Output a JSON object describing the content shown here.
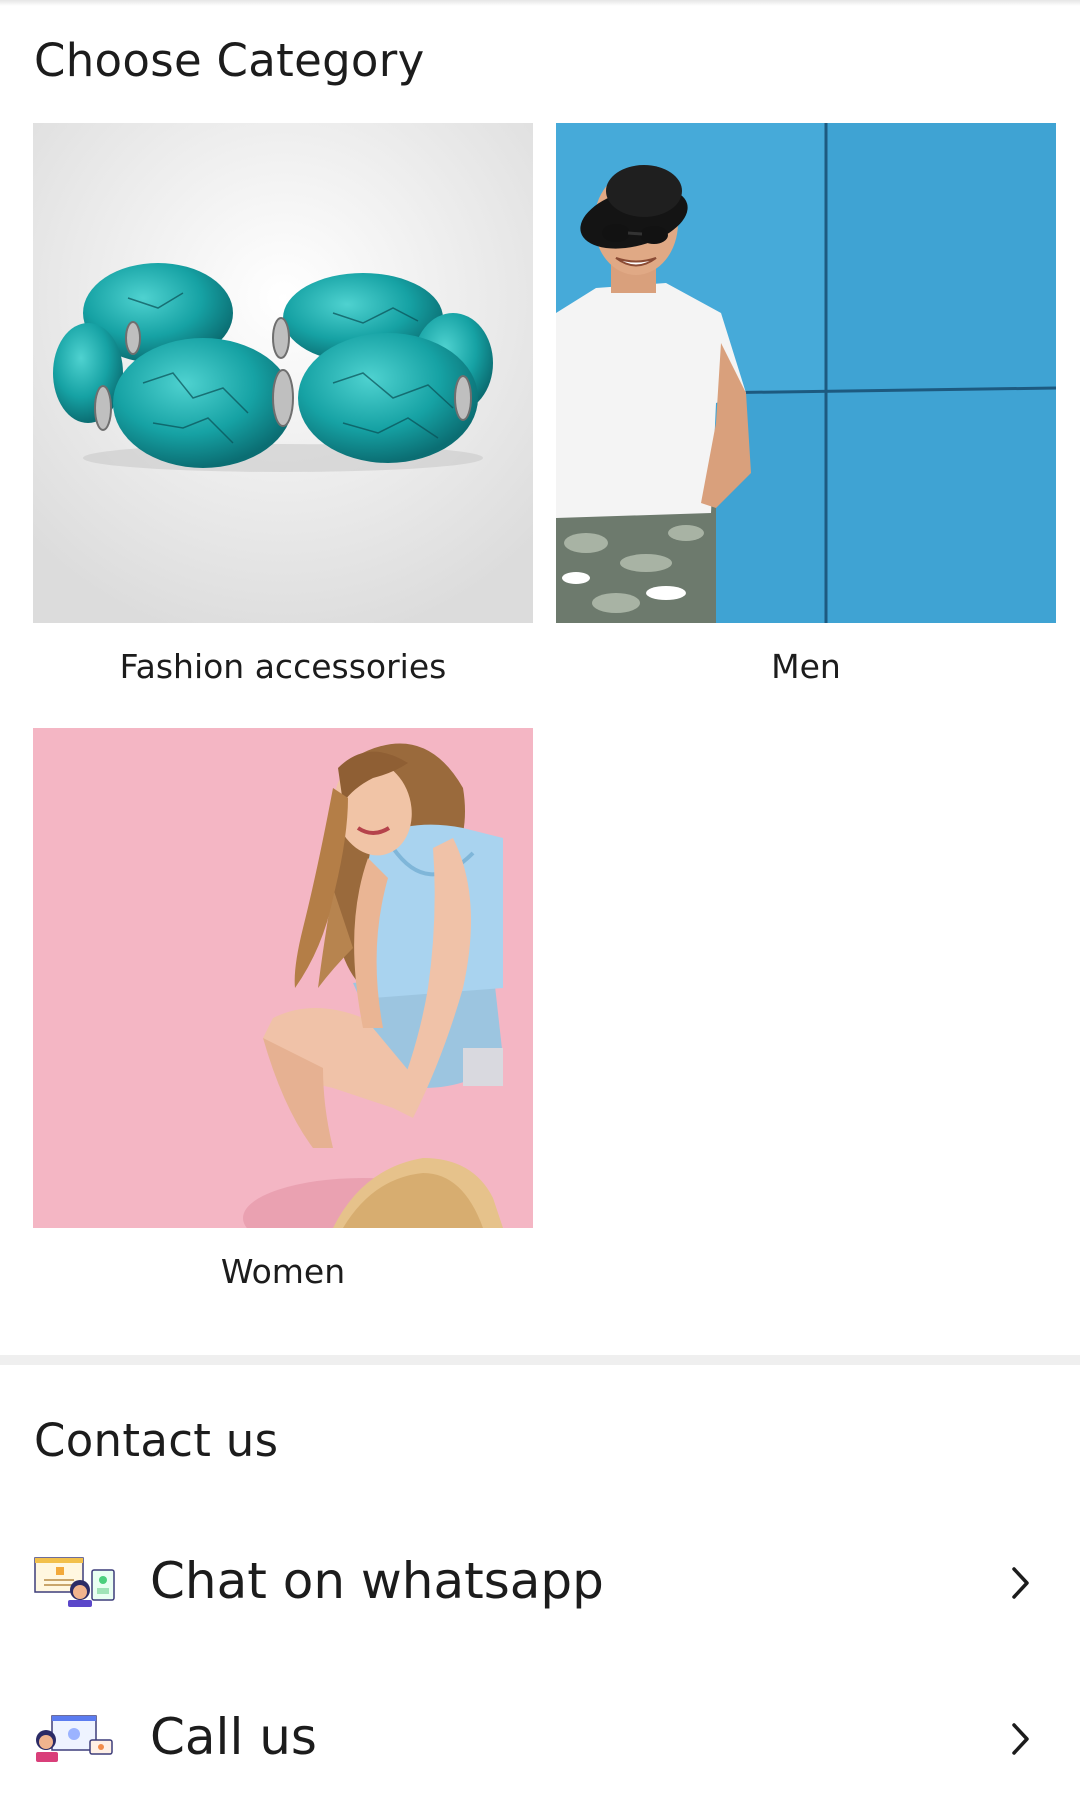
{
  "categories_section": {
    "title": "Choose Category",
    "items": [
      {
        "label": "Fashion accessories",
        "image": "turquoise-bracelet-photo"
      },
      {
        "label": "Men",
        "image": "man-in-white-tshirt-photo"
      },
      {
        "label": "Women",
        "image": "woman-on-pink-background-photo"
      }
    ]
  },
  "contact_section": {
    "title": "Contact us",
    "rows": [
      {
        "label": "Chat on whatsapp",
        "icon": "chat-support-illustration-icon"
      },
      {
        "label": "Call us",
        "icon": "call-support-illustration-icon"
      }
    ]
  },
  "colors": {
    "text": "#1c1c1c",
    "divider": "#efefef",
    "men_background": "#3fa3d3",
    "women_background": "#f4b6c4",
    "bracelet": "#1fa5a8"
  }
}
